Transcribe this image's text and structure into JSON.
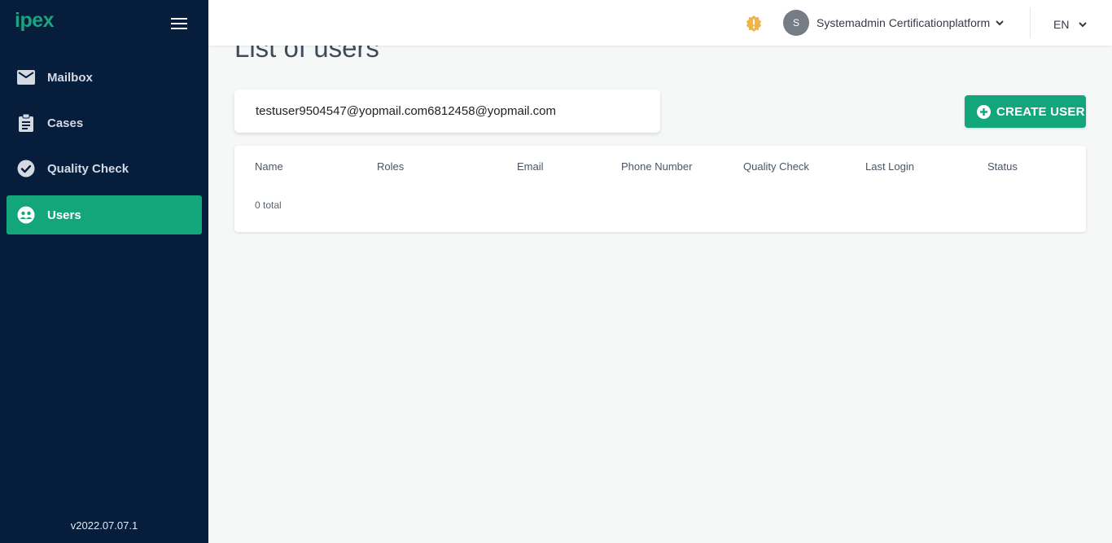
{
  "sidebar": {
    "logo": "ipex",
    "items": [
      {
        "label": "Mailbox",
        "icon": "mail-icon",
        "active": false
      },
      {
        "label": "Cases",
        "icon": "clipboard-icon",
        "active": false
      },
      {
        "label": "Quality Check",
        "icon": "check-circle-icon",
        "active": false
      },
      {
        "label": "Users",
        "icon": "users-icon",
        "active": true
      }
    ],
    "version": "v2022.07.07.1"
  },
  "header": {
    "avatar_initial": "S",
    "user_name": "Systemadmin Certificationplatform",
    "language": "EN",
    "alert_color": "#f0b54a"
  },
  "main": {
    "title": "List of users",
    "search": {
      "value": "testuser9504547@yopmail.com6812458@yopmail.com",
      "placeholder": ""
    },
    "create_button_label": "CREATE USER",
    "table": {
      "columns": [
        "Name",
        "Roles",
        "Email",
        "Phone Number",
        "Quality Check",
        "Last Login",
        "Status"
      ],
      "rows": [],
      "total_label": "0 total"
    }
  },
  "colors": {
    "sidebar_bg": "#061d3c",
    "accent": "#13a67d",
    "page_bg": "#f6f8f8"
  }
}
